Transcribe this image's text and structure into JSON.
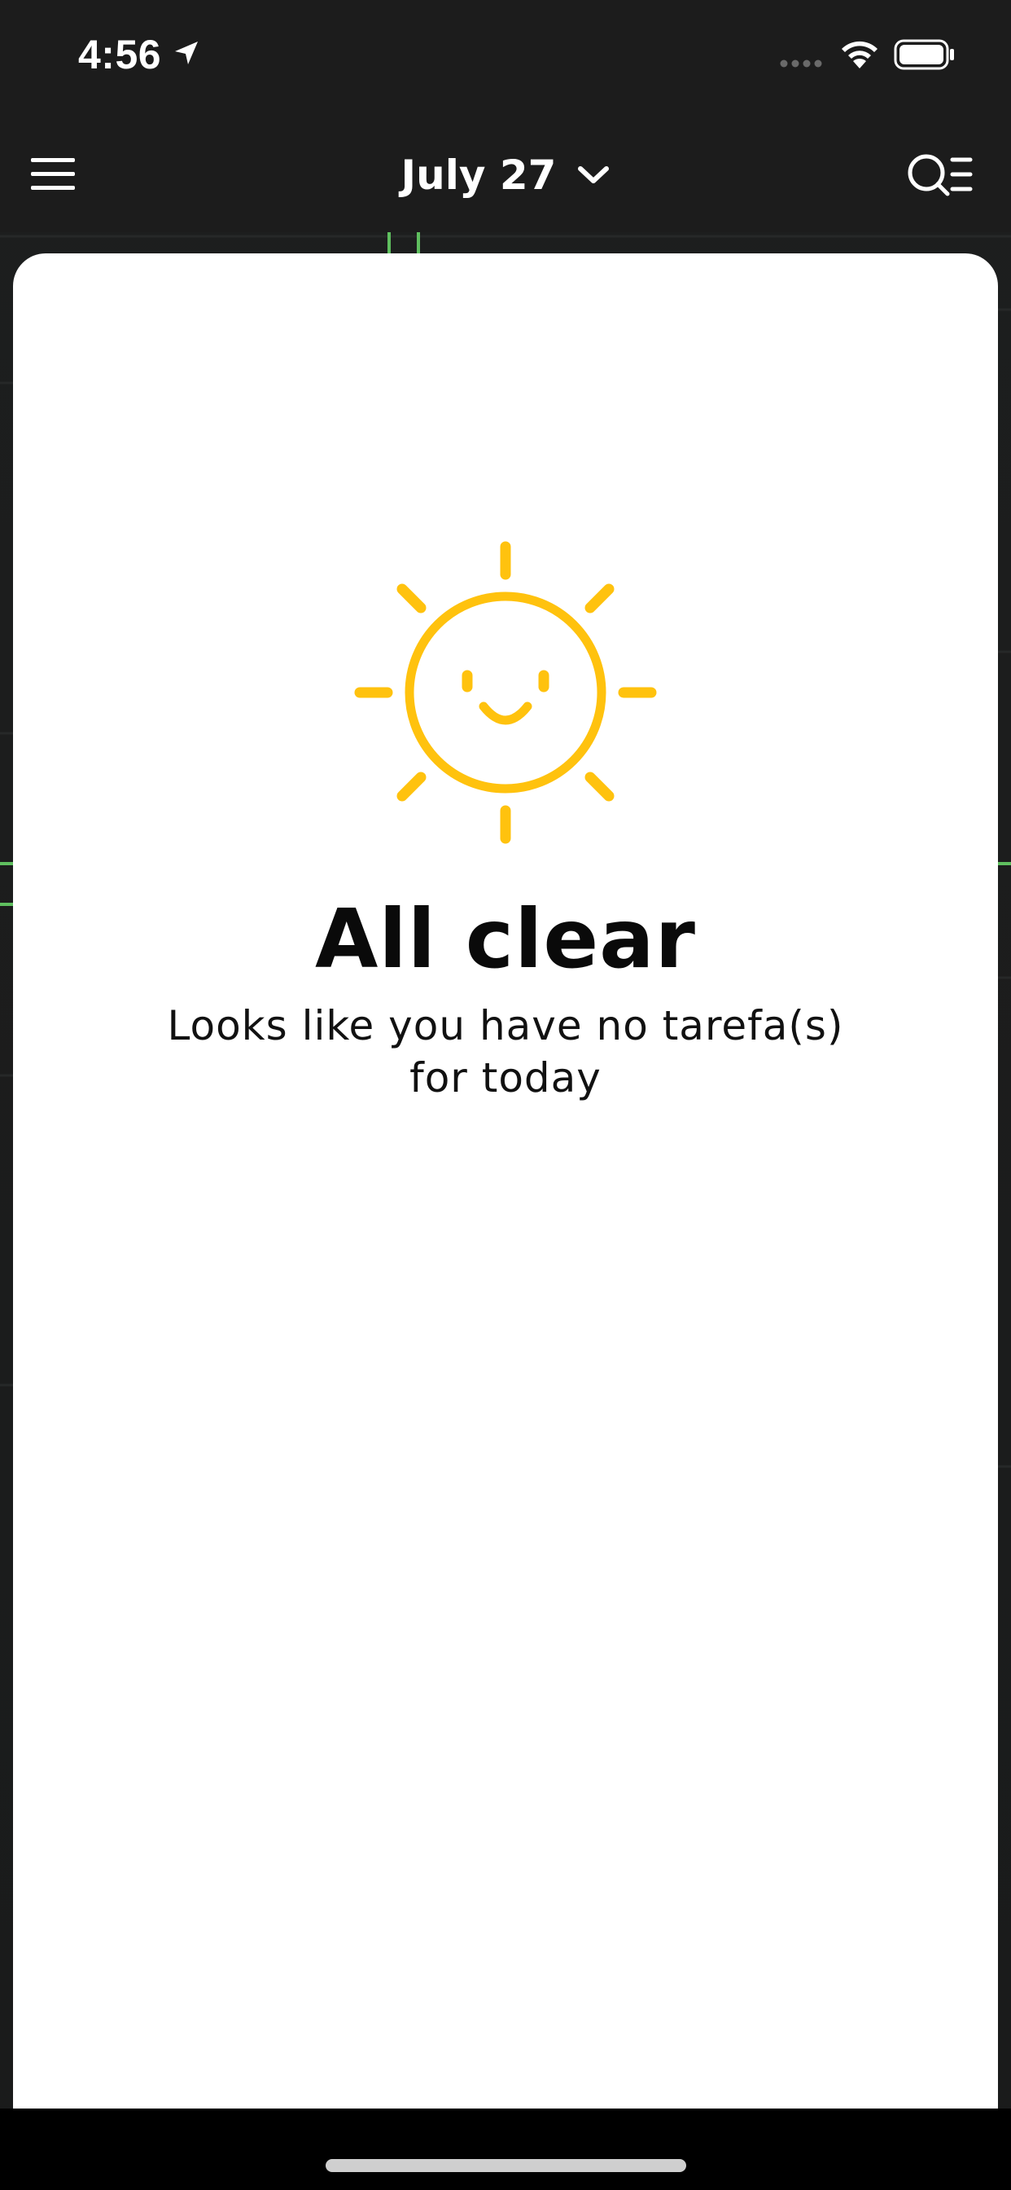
{
  "status_bar": {
    "time": "4:56",
    "icons": [
      "location-arrow-icon",
      "signal-icon",
      "wifi-icon",
      "battery-icon"
    ]
  },
  "nav": {
    "date_label": "July 27",
    "icons": [
      "menu-icon",
      "chevron-down-icon",
      "search-filter-icon"
    ]
  },
  "empty_state": {
    "title": "All clear",
    "subtitle": "Looks like you have no tarefa(s) for today",
    "icon": "smiling-sun-icon"
  },
  "colors": {
    "background": "#1c1c1c",
    "card": "#ffffff",
    "sun": "#ffc20e",
    "map_route": "#5fbf5f"
  }
}
